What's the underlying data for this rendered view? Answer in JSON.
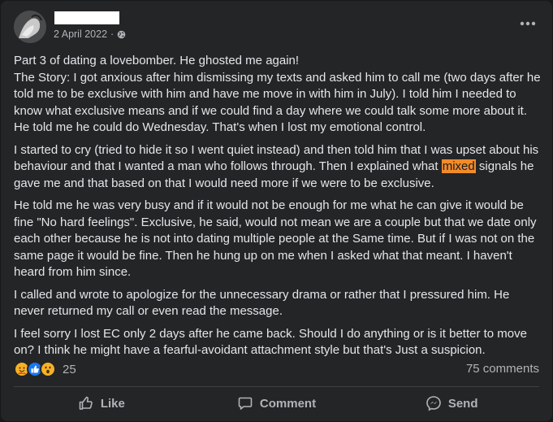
{
  "post": {
    "date": "2 April 2022",
    "separator": "·",
    "paragraphs": [
      {
        "text": "Part 3 of dating a lovebomber. He ghosted me again!\nThe Story: I got anxious after him dismissing my texts and asked him to call me (two days after he told me to be exclusive with him and have me move in with him in July). I told him I needed to know what exclusive means and if we could find a day where we could talk some more about it. He told me he could do Wednesday. That's when I lost my emotional control."
      },
      {
        "text_before": "I started to cry (tried to hide it so I went quiet instead) and then told him that I was upset about his behaviour and that I wanted a man who follows through. Then I explained what ",
        "highlight": "mixed",
        "text_after": " signals he gave me and that based on that I would need more if we were to be exclusive."
      },
      {
        "text": "He told me he was very busy and if it would not be enough for me what he can give it would be fine \"No hard feelings\". Exclusive, he said, would not mean we are a couple but that we date only each other because he is not into dating multiple people at the Same time. But if I was not on the same page it would be fine. Then he hung up on me when I asked what that meant. I haven't heard from him since."
      },
      {
        "text": "I called and wrote to apologize for the unnecessary drama or rather that I pressured him. He never returned my call or even read the message."
      },
      {
        "text": "I feel sorry I lost EC only 2 days after he came back. Should I do anything or is it better to move on? I think he might have a fearful-avoidant attachment style but that's Just a suspicion."
      }
    ]
  },
  "reactions": {
    "icons": [
      "care-reaction",
      "like-reaction",
      "wow-reaction"
    ],
    "count": "25"
  },
  "comments": {
    "label": "75 comments"
  },
  "actions": {
    "like": "Like",
    "comment": "Comment",
    "send": "Send"
  },
  "colors": {
    "background": "#242526",
    "text": "#e4e6eb",
    "secondary_text": "#b0b3b8",
    "highlight": "#f28b2a",
    "like_blue": "#1877f2",
    "reaction_yellow": "#f7b125"
  }
}
